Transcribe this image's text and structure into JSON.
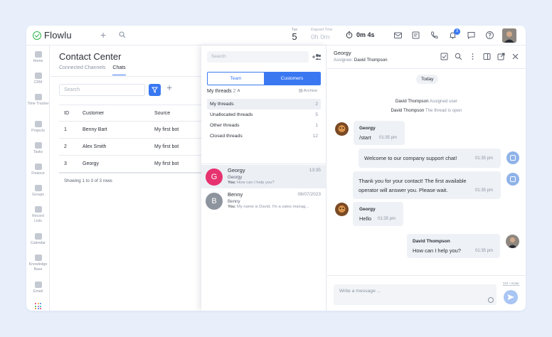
{
  "app": {
    "name": "Flowlu"
  },
  "topbar": {
    "day_of_week": "Tue",
    "day_number": "5",
    "elapsed_label": "Elapsed Time",
    "elapsed_value": "0h 0m",
    "timer_value": "0m 4s",
    "notification_count": "3",
    "icons": [
      "add-icon",
      "search-icon",
      "stopwatch-icon",
      "mail-icon",
      "tasks-icon",
      "phone-icon",
      "bell-icon",
      "chat-icon",
      "help-icon"
    ]
  },
  "leftnav": {
    "items": [
      {
        "label": "Home",
        "icon": "home-icon"
      },
      {
        "label": "CRM",
        "icon": "crm-icon"
      },
      {
        "label": "Time Tracker",
        "icon": "time-tracker-icon"
      },
      {
        "label": "Projects",
        "icon": "projects-icon"
      },
      {
        "label": "Tasks",
        "icon": "tasks-icon"
      },
      {
        "label": "Finance",
        "icon": "finance-icon"
      },
      {
        "label": "Groups",
        "icon": "groups-icon"
      },
      {
        "label": "Record Lists",
        "icon": "record-lists-icon"
      },
      {
        "label": "Calendar",
        "icon": "calendar-icon"
      },
      {
        "label": "Knowledge Base",
        "icon": "knowledge-base-icon"
      },
      {
        "label": "Email",
        "icon": "email-icon"
      }
    ]
  },
  "contact_center": {
    "title": "Contact Center",
    "tabs": [
      {
        "label": "Connected Channels",
        "active": false
      },
      {
        "label": "Chats",
        "active": true
      }
    ],
    "search_placeholder": "Search",
    "columns": {
      "id": "ID",
      "customer": "Customer",
      "source": "Source"
    },
    "rows": [
      {
        "id": "1",
        "customer": "Benny Bart",
        "source": "My first bot"
      },
      {
        "id": "2",
        "customer": "Alex Smith",
        "source": "My first bot"
      },
      {
        "id": "3",
        "customer": "Georgy",
        "source": "My first bot"
      }
    ],
    "footer": "Showing 1 to 3 of 3 rows"
  },
  "threads": {
    "search_placeholder": "Search",
    "segments": {
      "team": "Team",
      "customers": "Customers"
    },
    "my_threads_label": "My threads",
    "my_threads_count": "2",
    "archive_label": "Archive",
    "filters": [
      {
        "label": "My threads",
        "count": "2",
        "active": true
      },
      {
        "label": "Unallocated threads",
        "count": "5",
        "active": false
      },
      {
        "label": "Other threads",
        "count": "1",
        "active": false
      },
      {
        "label": "Closed threads",
        "count": "12",
        "active": false
      }
    ],
    "conversations": [
      {
        "initial": "G",
        "name": "Georgy",
        "time": "13:35",
        "subtitle": "Georgy",
        "you_label": "You:",
        "preview": "How can I help you?",
        "avatar_color": "#e6336f",
        "active": true
      },
      {
        "initial": "B",
        "name": "Benny",
        "time": "08/07/2023",
        "subtitle": "Benny",
        "you_label": "You:",
        "preview": "My name is David, I'm a sales manag...",
        "avatar_color": "#8e949e",
        "active": false
      }
    ]
  },
  "chat": {
    "contact_name": "Georgy",
    "assignee_label": "Assignee:",
    "assignee_name": "David Thompson",
    "date_chip": "Today",
    "system_messages": [
      {
        "actor": "David Thompson",
        "text": "Assigned user"
      },
      {
        "actor": "David Thompson",
        "text": "The thread is open"
      }
    ],
    "messages": [
      {
        "sender": "Georgy",
        "text": "/start",
        "time": "01:35 pm"
      },
      {
        "sender": "",
        "text": "Welcome to our company support chat!",
        "time": "01:35 pm"
      },
      {
        "sender": "",
        "text_line1": "Thank you for your contact! The first available",
        "text_line2": "operator will answer you. Please wait.",
        "time": "01:35 pm"
      },
      {
        "sender": "Georgy",
        "text": "Hello",
        "time": "01:35 pm"
      },
      {
        "sender": "David Thompson",
        "text": "How can I help you?",
        "time": "01:35 pm"
      }
    ],
    "composer_placeholder": "Write a message ...",
    "composer_hint": "Ctrl + Enter"
  },
  "colors": {
    "accent": "#3a78f2",
    "brand_green": "#2fb34d"
  }
}
